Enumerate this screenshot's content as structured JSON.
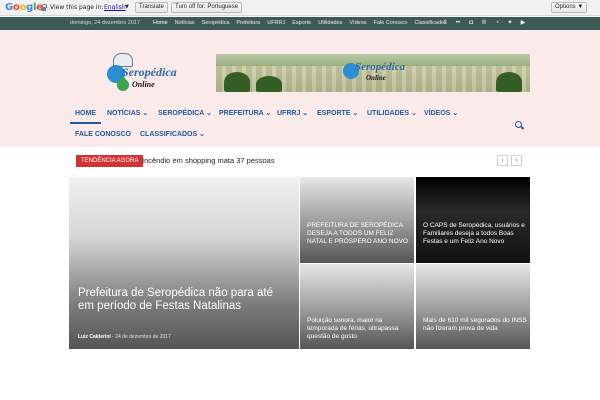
{
  "translate_bar": {
    "logo": "Google",
    "prompt": "View this page in:",
    "language": "English",
    "translate_button": "Translate",
    "turn_off_button": "Turn off for: Portuguese",
    "options_button": "Options ▼"
  },
  "top_nav": {
    "date": "domingo, 24 dezembro 2017",
    "links": [
      "Home",
      "Notícias",
      "Seropédica",
      "Prefeitura",
      "UFRRJ",
      "Esporte",
      "Utilidades",
      "Vídeos",
      "Fale Conosco",
      "Classificados"
    ],
    "social_icons": [
      "facebook-icon",
      "flickr-icon",
      "instagram-icon",
      "pinterest-icon",
      "rss-icon",
      "twitter-icon",
      "youtube-icon"
    ]
  },
  "logo": {
    "name": "Seropédica",
    "sub": "Online"
  },
  "banner": {
    "name": "Seropédica",
    "sub": "Online"
  },
  "main_nav": {
    "items": [
      "HOME",
      "NOTÍCIAS ⌄",
      "SEROPÉDICA ⌄",
      "PREFEITURA ⌄",
      "UFRRJ ⌄",
      "ESPORTE ⌄",
      "UTILIDADES ⌄",
      "VÍDEOS ⌄",
      "FALE CONOSCO",
      "CLASSIFICADOS ⌄"
    ]
  },
  "trending": {
    "label": "TENDÊNCIA AGORA",
    "headline": "Incêndio em shopping mata 37 pessoas",
    "prev": "‹",
    "next": "›"
  },
  "featured": {
    "big": {
      "title": "Prefeitura de Seropédica não para até em período de Festas Natalinas",
      "author": "Luiz Calderini",
      "date": "- 24 de dezembro de 2017"
    },
    "tiles": [
      {
        "title": "PREFEITURA DE SEROPÉDICA DESEJA A TODOS UM FELIZ NATAL E PRÓSPERO ANO NOVO"
      },
      {
        "title": "O CAPS de Seropédica, usuários e Familiares deseja a todos Boas Festas e um Feliz Ano Novo"
      },
      {
        "title": "Poluição sonora, maior na temporada de férias, ultrapassa questão de gosto"
      },
      {
        "title": "Mais de 610 mil segurados do INSS não fizeram prova de vida"
      }
    ]
  },
  "colors": {
    "top_nav_bg": "#3d5a54",
    "header_bg": "#faeaea",
    "nav_text": "#1f5aa0",
    "trending_bg": "#d23434"
  }
}
